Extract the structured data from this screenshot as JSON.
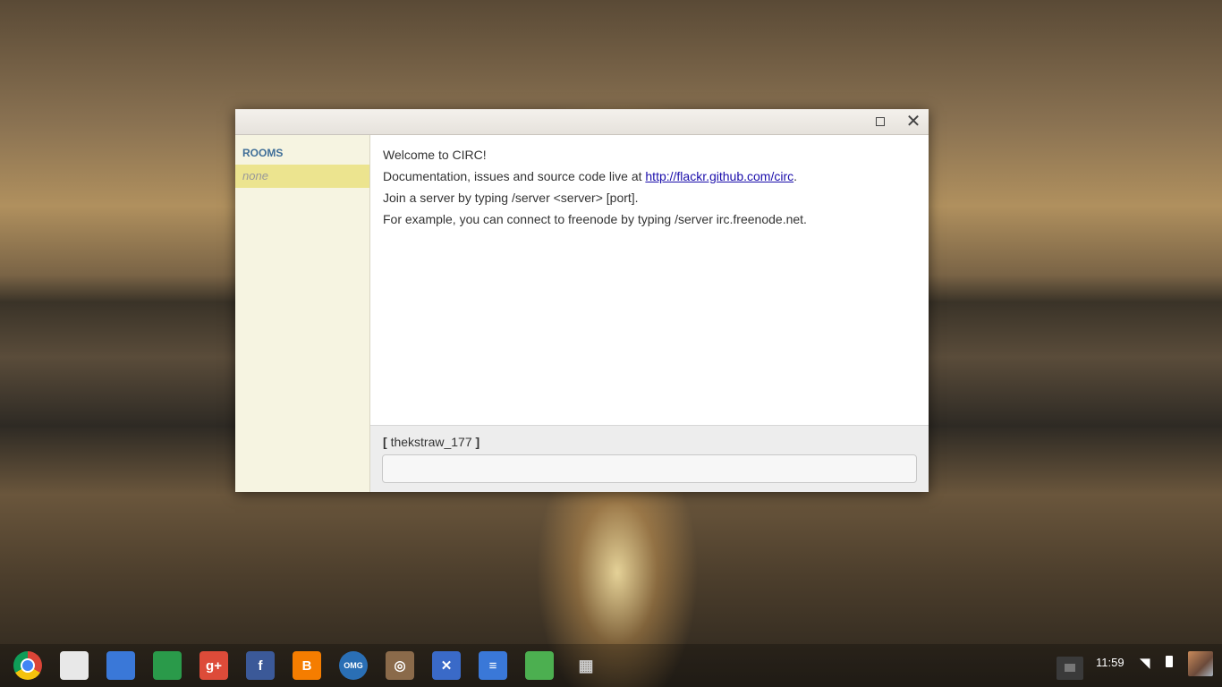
{
  "window": {
    "maximize_icon": "maximize-icon",
    "close_icon": "close-icon"
  },
  "sidebar": {
    "title": "ROOMS",
    "items": [
      {
        "label": "none"
      }
    ]
  },
  "messages": [
    {
      "text": "Welcome to CIRC!"
    },
    {
      "prefix": "Documentation, issues and source code live at ",
      "link": "http://flackr.github.com/circ",
      "suffix": "."
    },
    {
      "text": "Join a server by typing /server <server> [port]."
    },
    {
      "text": "For example, you can connect to freenode by typing /server irc.freenode.net."
    }
  ],
  "input": {
    "nick_open": "[",
    "nick": "thekstraw_177",
    "nick_close": "]",
    "value": "",
    "placeholder": ""
  },
  "shelf": {
    "apps": [
      {
        "name": "chrome-icon",
        "glyph": "",
        "color": "#dd4b39"
      },
      {
        "name": "web-store-icon",
        "glyph": "",
        "color": "#e8e8e8"
      },
      {
        "name": "files-icon",
        "glyph": "",
        "color": "#3a78d8"
      },
      {
        "name": "drive-icon",
        "glyph": "",
        "color": "#2a9a4a"
      },
      {
        "name": "google-plus-icon",
        "glyph": "g+",
        "color": "#dd4b39"
      },
      {
        "name": "facebook-icon",
        "glyph": "f",
        "color": "#3b5998"
      },
      {
        "name": "blogger-icon",
        "glyph": "B",
        "color": "#f57d00"
      },
      {
        "name": "omg-chrome-icon",
        "glyph": "OMG",
        "color": "#2a6fb5"
      },
      {
        "name": "instagram-icon",
        "glyph": "◎",
        "color": "#8a6a4a"
      },
      {
        "name": "tools-icon",
        "glyph": "✕",
        "color": "#3a6ac8"
      },
      {
        "name": "docs-icon",
        "glyph": "≡",
        "color": "#3a78d8"
      },
      {
        "name": "chrome-remote-icon",
        "glyph": "",
        "color": "#4caf50"
      },
      {
        "name": "app-launcher-icon",
        "glyph": "▦",
        "color": "transparent"
      }
    ],
    "clock": "11:59",
    "notification_icon": "notification-icon",
    "wifi_icon": "wifi-icon",
    "battery_icon": "battery-icon"
  }
}
